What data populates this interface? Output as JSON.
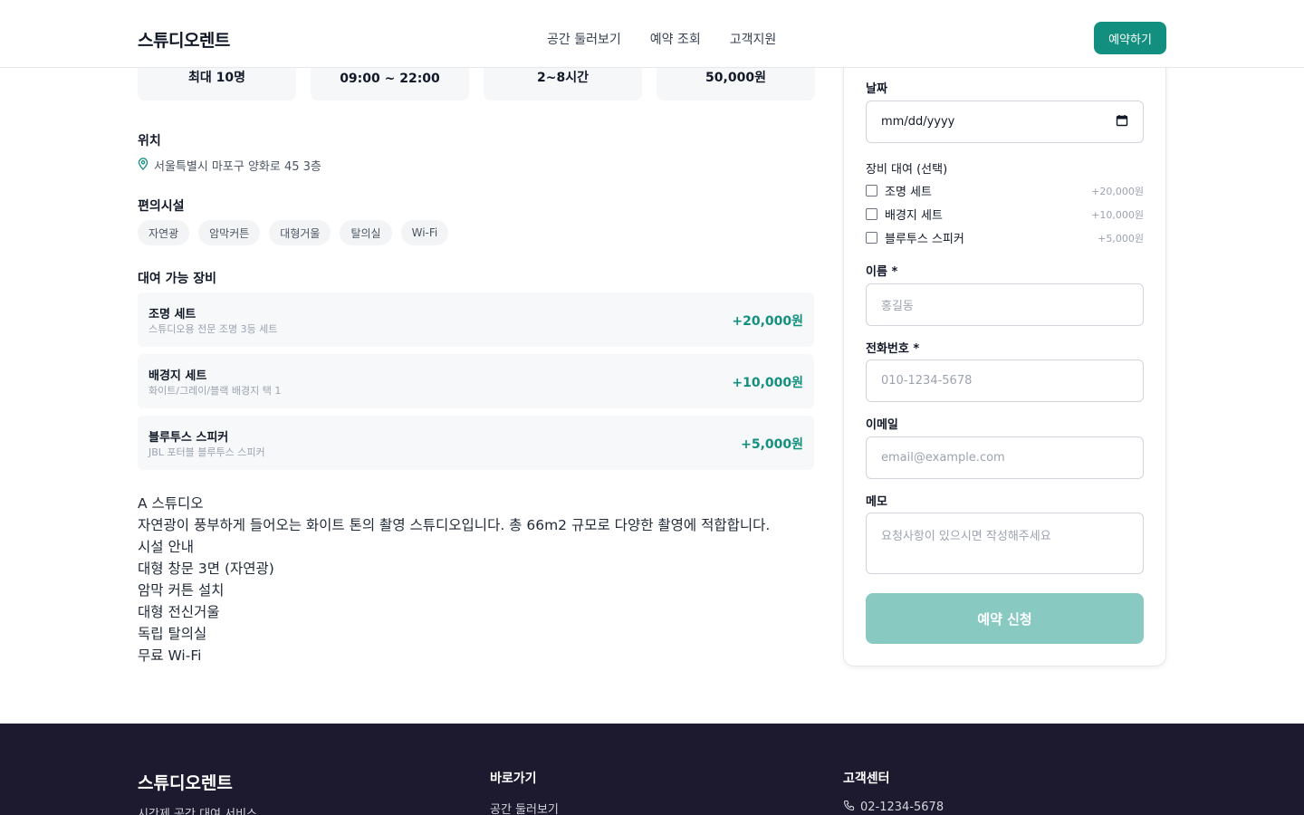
{
  "header": {
    "logo": "스튜디오렌트",
    "nav": [
      "공간 둘러보기",
      "예약 조회",
      "고객지원"
    ],
    "cta": "예약하기"
  },
  "stats": [
    "최대 10명",
    "09:00 ~ 22:00",
    "2~8시간",
    "50,000원"
  ],
  "location": {
    "title": "위치",
    "address": "서울특별시 마포구 양화로 45 3층"
  },
  "amenities": {
    "title": "편의시설",
    "items": [
      "자연광",
      "암막커튼",
      "대형거울",
      "탈의실",
      "Wi-Fi"
    ]
  },
  "equipment": {
    "title": "대여 가능 장비",
    "items": [
      {
        "name": "조명 세트",
        "desc": "스튜디오용 전문 조명 3등 세트",
        "price": "+20,000원"
      },
      {
        "name": "배경지 세트",
        "desc": "화이트/그레이/블랙 배경지 택 1",
        "price": "+10,000원"
      },
      {
        "name": "블루투스 스피커",
        "desc": "JBL 포터블 블루투스 스피커",
        "price": "+5,000원"
      }
    ]
  },
  "description": [
    "A 스튜디오",
    "자연광이 풍부하게 들어오는 화이트 톤의 촬영 스튜디오입니다. 총 66m2 규모로 다양한 촬영에 적합합니다.",
    "시설 안내",
    "대형 창문 3면 (자연광)",
    "암막 커튼 설치",
    "대형 전신거울",
    "독립 탈의실",
    "무료 Wi-Fi"
  ],
  "booking": {
    "date_label": "날짜",
    "date_value": "mm/dd/yyyy",
    "equip_label": "장비 대여 (선택)",
    "options": [
      {
        "name": "조명 세트",
        "price": "+20,000원"
      },
      {
        "name": "배경지 세트",
        "price": "+10,000원"
      },
      {
        "name": "블루투스 스피커",
        "price": "+5,000원"
      }
    ],
    "name_label": "이름 *",
    "name_placeholder": "홍길동",
    "phone_label": "전화번호 *",
    "phone_placeholder": "010-1234-5678",
    "email_label": "이메일",
    "email_placeholder": "email@example.com",
    "memo_label": "메모",
    "memo_placeholder": "요청사항이 있으시면 작성해주세요",
    "submit": "예약 신청"
  },
  "footer": {
    "logo": "스튜디오렌트",
    "tagline": "시간제 공간 대여 서비스",
    "links_title": "바로가기",
    "links": [
      "공간 둘러보기"
    ],
    "support_title": "고객센터",
    "phone": "02-1234-5678"
  },
  "colors": {
    "accent": "#138f7f",
    "accent_disabled": "#88c9c1",
    "footer_bg": "#1d1a2f"
  }
}
